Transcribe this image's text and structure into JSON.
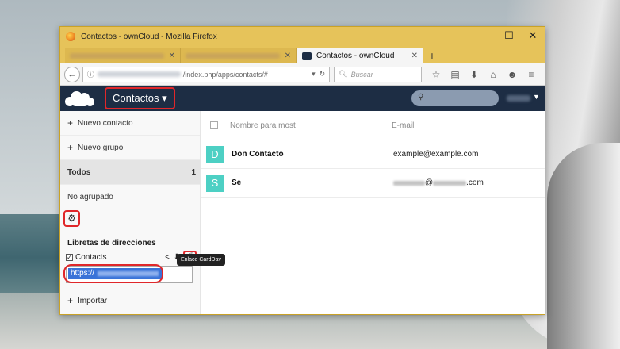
{
  "window": {
    "title": "Contactos - ownCloud - Mozilla Firefox",
    "controls": {
      "minimize": "—",
      "maximize": "☐",
      "close": "✕"
    }
  },
  "tabs": [
    {
      "label": "",
      "active": false
    },
    {
      "label": "",
      "active": false
    },
    {
      "label": "Contactos - ownCloud",
      "active": true
    }
  ],
  "navbar": {
    "url_suffix": "/index.php/apps/contacts/#",
    "search_placeholder": "Buscar"
  },
  "app": {
    "name": "Contactos",
    "caret": "▾"
  },
  "sidebar": {
    "new_contact": "Nuevo contacto",
    "new_group": "Nuevo grupo",
    "groups": [
      {
        "label": "Todos",
        "count": "1",
        "selected": true
      },
      {
        "label": "No agrupado",
        "count": "",
        "selected": false
      }
    ],
    "addressbooks_title": "Libretas de direcciones",
    "addressbook": {
      "name": "Contacts",
      "checked": true
    },
    "tooltip": "Enlace CardDav",
    "carddav_value": "https://",
    "import_label": "Importar"
  },
  "contacts": {
    "col_name": "Nombre para most",
    "col_email": "E-mail",
    "rows": [
      {
        "initial": "D",
        "name": "Don Contacto",
        "email_prefix": "example@example.com",
        "email_suffix": ""
      },
      {
        "initial": "S",
        "name": "Se",
        "email_prefix": "@",
        "email_suffix": ".com"
      }
    ]
  },
  "colors": {
    "accent_red": "#e0272a",
    "header_bg": "#1d2d44",
    "avatar_bg": "#4dd0c4",
    "titlebar": "#e6c35a"
  }
}
